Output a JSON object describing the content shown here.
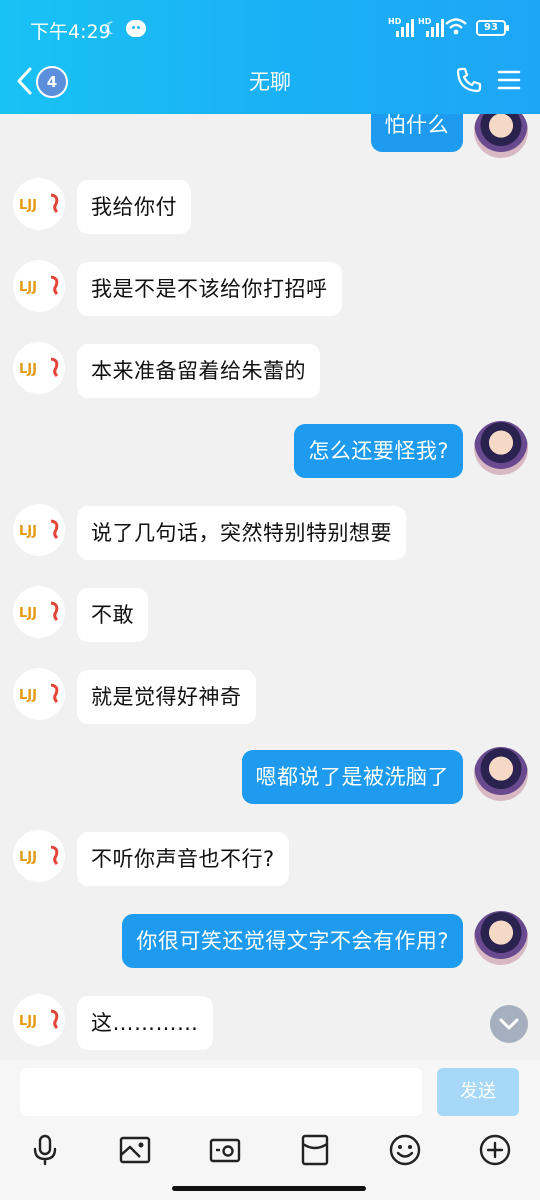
{
  "status_bar": {
    "time": "下午4:29",
    "battery": "93"
  },
  "header": {
    "title": "无聊",
    "unread_count": "4"
  },
  "colors": {
    "header": "#1ab1f5",
    "outgoing_bubble": "#1e9bef",
    "send_button": "#a7d8f7"
  },
  "messages": [
    {
      "from": "me",
      "text": "怕什么"
    },
    {
      "from": "them",
      "text": "我给你付"
    },
    {
      "from": "them",
      "text": "我是不是不该给你打招呼"
    },
    {
      "from": "them",
      "text": "本来准备留着给朱蕾的"
    },
    {
      "from": "me",
      "text": "怎么还要怪我?"
    },
    {
      "from": "them",
      "text": "说了几句话，突然特别特别想要"
    },
    {
      "from": "them",
      "text": "不敢"
    },
    {
      "from": "them",
      "text": "就是觉得好神奇"
    },
    {
      "from": "me",
      "text": "嗯都说了是被洗脑了"
    },
    {
      "from": "them",
      "text": "不听你声音也不行?"
    },
    {
      "from": "me",
      "text": "你很可笑还觉得文字不会有作用?"
    },
    {
      "from": "them",
      "text": "这…………"
    }
  ],
  "input": {
    "placeholder": "",
    "send_label": "发送"
  },
  "toolbar": [
    "microphone-icon",
    "image-icon",
    "camera-icon",
    "red-packet-icon",
    "emoji-icon",
    "plus-icon"
  ]
}
